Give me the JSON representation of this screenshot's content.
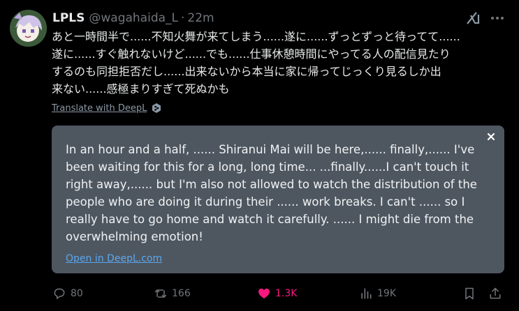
{
  "post": {
    "display_name": "LPLS",
    "handle": "@wagahaida_L",
    "separator": "·",
    "time": "22m",
    "text": "あと一時間半で......不知火舞が来てしまう......遂に......ずっとずっと待ってて......\n遂に......すぐ触れないけど......でも......仕事休憩時間にやってる人の配信見たり\nするのも同担拒否だし......出来ないから本当に家に帰ってじっくり見るしか出\n来ない......感極まりすぎて死ぬかも",
    "translate_label": "Translate with DeepL"
  },
  "translation": {
    "text": "In an hour and a half, ...... Shiranui Mai will be here,...... finally,...... I've been waiting for this for a long, long time... ...finally......I can't touch it right away,...... but I'm also not allowed to watch the distribution of the people who are doing it during their ...... work breaks. I can't ...... so I really have to go home and watch it carefully. ...... I might die from the overwhelming emotion!",
    "open_link": "Open in DeepL.com"
  },
  "actions": {
    "replies": "80",
    "reposts": "166",
    "likes": "1.3K",
    "views": "19K"
  },
  "colors": {
    "like": "#f91880",
    "link": "#5ba7ef",
    "muted": "#71767b"
  }
}
